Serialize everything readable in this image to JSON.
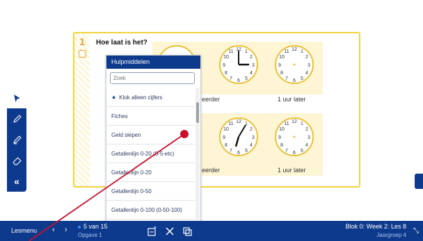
{
  "exercise": {
    "number": "1",
    "title": "Hoe laat is het?",
    "rows": [
      {
        "labels": [
          "1 uur eerder",
          "1 uur later"
        ]
      },
      {
        "labels": [
          "1 uur eerder",
          "1 uur later"
        ]
      }
    ]
  },
  "toolbar": {
    "tools": [
      "pointer-icon",
      "pen-icon",
      "highlighter-icon",
      "eraser-icon",
      "collapse-icon"
    ],
    "collapse_label": "«"
  },
  "panel": {
    "header": "Hulpmiddelen",
    "search_placeholder": "Zoek",
    "items": [
      {
        "label": "Klok alleen cijfers",
        "pinned": true
      },
      {
        "label": "Fiches"
      },
      {
        "label": "Geld slepen"
      },
      {
        "label": "Getallenlijn 0-20 (0-5-etc)"
      },
      {
        "label": "Getallenlijn 0-20"
      },
      {
        "label": "Getallenlijn 0-50"
      },
      {
        "label": "Getallenlijn 0-100 (0-50-100)"
      }
    ]
  },
  "bottombar": {
    "lesmenu": "Lesmenu",
    "prev": "‹",
    "next": "›",
    "pager": "5 van 15",
    "opgave": "Opgave 1",
    "blok": "Blok 0: Week 2: Les 8",
    "jaargroep": "Jaargroep 4",
    "icons": [
      "add-slide-icon",
      "tools-icon",
      "copy-icon"
    ]
  },
  "colors": {
    "navy": "#0d3a8c",
    "yellow": "#f2d33a",
    "annotation": "#c8102e"
  }
}
